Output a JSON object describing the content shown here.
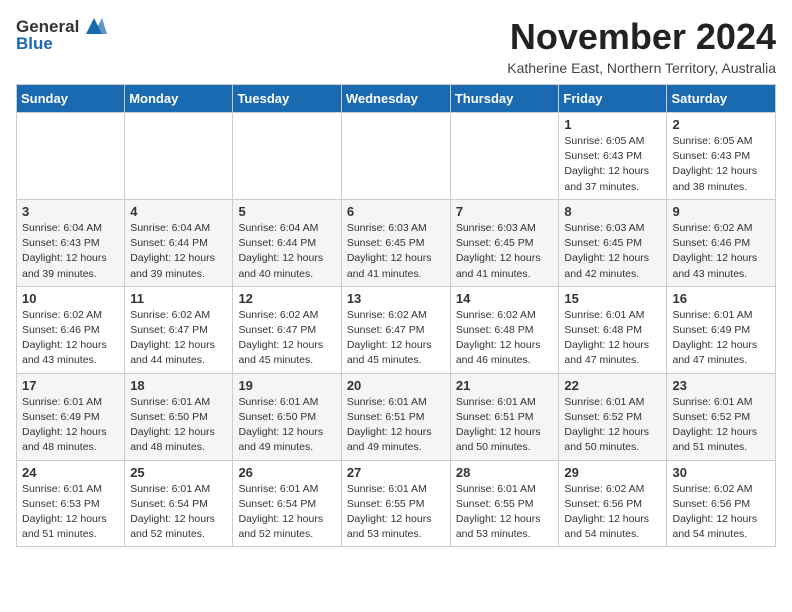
{
  "logo": {
    "general": "General",
    "blue": "Blue"
  },
  "title": "November 2024",
  "subtitle": "Katherine East, Northern Territory, Australia",
  "days_header": [
    "Sunday",
    "Monday",
    "Tuesday",
    "Wednesday",
    "Thursday",
    "Friday",
    "Saturday"
  ],
  "weeks": [
    [
      {
        "day": "",
        "detail": ""
      },
      {
        "day": "",
        "detail": ""
      },
      {
        "day": "",
        "detail": ""
      },
      {
        "day": "",
        "detail": ""
      },
      {
        "day": "",
        "detail": ""
      },
      {
        "day": "1",
        "detail": "Sunrise: 6:05 AM\nSunset: 6:43 PM\nDaylight: 12 hours\nand 37 minutes."
      },
      {
        "day": "2",
        "detail": "Sunrise: 6:05 AM\nSunset: 6:43 PM\nDaylight: 12 hours\nand 38 minutes."
      }
    ],
    [
      {
        "day": "3",
        "detail": "Sunrise: 6:04 AM\nSunset: 6:43 PM\nDaylight: 12 hours\nand 39 minutes."
      },
      {
        "day": "4",
        "detail": "Sunrise: 6:04 AM\nSunset: 6:44 PM\nDaylight: 12 hours\nand 39 minutes."
      },
      {
        "day": "5",
        "detail": "Sunrise: 6:04 AM\nSunset: 6:44 PM\nDaylight: 12 hours\nand 40 minutes."
      },
      {
        "day": "6",
        "detail": "Sunrise: 6:03 AM\nSunset: 6:45 PM\nDaylight: 12 hours\nand 41 minutes."
      },
      {
        "day": "7",
        "detail": "Sunrise: 6:03 AM\nSunset: 6:45 PM\nDaylight: 12 hours\nand 41 minutes."
      },
      {
        "day": "8",
        "detail": "Sunrise: 6:03 AM\nSunset: 6:45 PM\nDaylight: 12 hours\nand 42 minutes."
      },
      {
        "day": "9",
        "detail": "Sunrise: 6:02 AM\nSunset: 6:46 PM\nDaylight: 12 hours\nand 43 minutes."
      }
    ],
    [
      {
        "day": "10",
        "detail": "Sunrise: 6:02 AM\nSunset: 6:46 PM\nDaylight: 12 hours\nand 43 minutes."
      },
      {
        "day": "11",
        "detail": "Sunrise: 6:02 AM\nSunset: 6:47 PM\nDaylight: 12 hours\nand 44 minutes."
      },
      {
        "day": "12",
        "detail": "Sunrise: 6:02 AM\nSunset: 6:47 PM\nDaylight: 12 hours\nand 45 minutes."
      },
      {
        "day": "13",
        "detail": "Sunrise: 6:02 AM\nSunset: 6:47 PM\nDaylight: 12 hours\nand 45 minutes."
      },
      {
        "day": "14",
        "detail": "Sunrise: 6:02 AM\nSunset: 6:48 PM\nDaylight: 12 hours\nand 46 minutes."
      },
      {
        "day": "15",
        "detail": "Sunrise: 6:01 AM\nSunset: 6:48 PM\nDaylight: 12 hours\nand 47 minutes."
      },
      {
        "day": "16",
        "detail": "Sunrise: 6:01 AM\nSunset: 6:49 PM\nDaylight: 12 hours\nand 47 minutes."
      }
    ],
    [
      {
        "day": "17",
        "detail": "Sunrise: 6:01 AM\nSunset: 6:49 PM\nDaylight: 12 hours\nand 48 minutes."
      },
      {
        "day": "18",
        "detail": "Sunrise: 6:01 AM\nSunset: 6:50 PM\nDaylight: 12 hours\nand 48 minutes."
      },
      {
        "day": "19",
        "detail": "Sunrise: 6:01 AM\nSunset: 6:50 PM\nDaylight: 12 hours\nand 49 minutes."
      },
      {
        "day": "20",
        "detail": "Sunrise: 6:01 AM\nSunset: 6:51 PM\nDaylight: 12 hours\nand 49 minutes."
      },
      {
        "day": "21",
        "detail": "Sunrise: 6:01 AM\nSunset: 6:51 PM\nDaylight: 12 hours\nand 50 minutes."
      },
      {
        "day": "22",
        "detail": "Sunrise: 6:01 AM\nSunset: 6:52 PM\nDaylight: 12 hours\nand 50 minutes."
      },
      {
        "day": "23",
        "detail": "Sunrise: 6:01 AM\nSunset: 6:52 PM\nDaylight: 12 hours\nand 51 minutes."
      }
    ],
    [
      {
        "day": "24",
        "detail": "Sunrise: 6:01 AM\nSunset: 6:53 PM\nDaylight: 12 hours\nand 51 minutes."
      },
      {
        "day": "25",
        "detail": "Sunrise: 6:01 AM\nSunset: 6:54 PM\nDaylight: 12 hours\nand 52 minutes."
      },
      {
        "day": "26",
        "detail": "Sunrise: 6:01 AM\nSunset: 6:54 PM\nDaylight: 12 hours\nand 52 minutes."
      },
      {
        "day": "27",
        "detail": "Sunrise: 6:01 AM\nSunset: 6:55 PM\nDaylight: 12 hours\nand 53 minutes."
      },
      {
        "day": "28",
        "detail": "Sunrise: 6:01 AM\nSunset: 6:55 PM\nDaylight: 12 hours\nand 53 minutes."
      },
      {
        "day": "29",
        "detail": "Sunrise: 6:02 AM\nSunset: 6:56 PM\nDaylight: 12 hours\nand 54 minutes."
      },
      {
        "day": "30",
        "detail": "Sunrise: 6:02 AM\nSunset: 6:56 PM\nDaylight: 12 hours\nand 54 minutes."
      }
    ]
  ]
}
